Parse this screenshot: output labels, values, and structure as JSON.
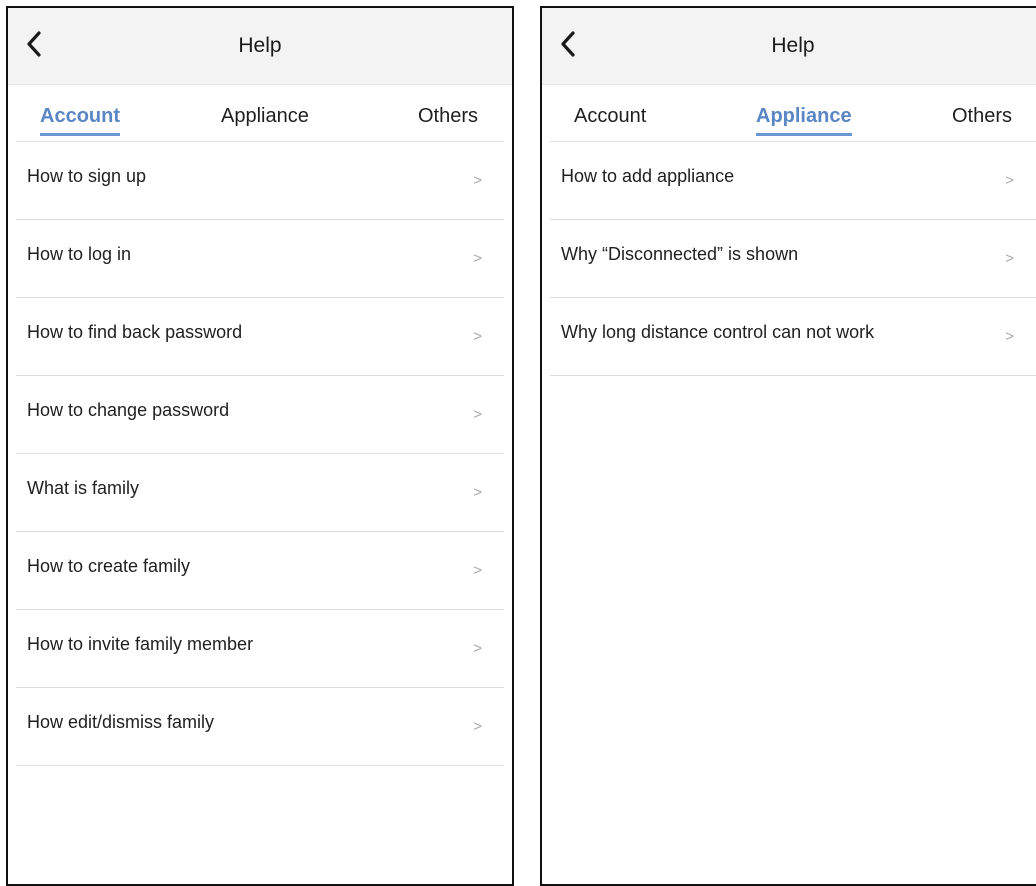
{
  "screens": [
    {
      "title": "Help",
      "tabs": [
        {
          "label": "Account",
          "active": true
        },
        {
          "label": "Appliance",
          "active": false
        },
        {
          "label": "Others",
          "active": false
        }
      ],
      "items": [
        {
          "label": "How to sign up"
        },
        {
          "label": "How to log in"
        },
        {
          "label": "How to find back password"
        },
        {
          "label": "How to change password"
        },
        {
          "label": "What is family"
        },
        {
          "label": "How to create family"
        },
        {
          "label": "How to invite family member"
        },
        {
          "label": "How edit/dismiss family"
        }
      ]
    },
    {
      "title": "Help",
      "tabs": [
        {
          "label": "Account",
          "active": false
        },
        {
          "label": "Appliance",
          "active": true
        },
        {
          "label": "Others",
          "active": false
        }
      ],
      "items": [
        {
          "label": "How to add appliance"
        },
        {
          "label": "Why “Disconnected” is shown"
        },
        {
          "label": "Why long distance control can not work"
        }
      ]
    }
  ],
  "chevron_glyph": ">",
  "colors": {
    "accent": "#5b86c4",
    "header_bg": "#f3f3f3",
    "divider": "#dedede",
    "chevron": "#a8a8a8"
  },
  "icons": {
    "back": "chevron-left-icon",
    "item_arrow": "chevron-right-icon"
  }
}
